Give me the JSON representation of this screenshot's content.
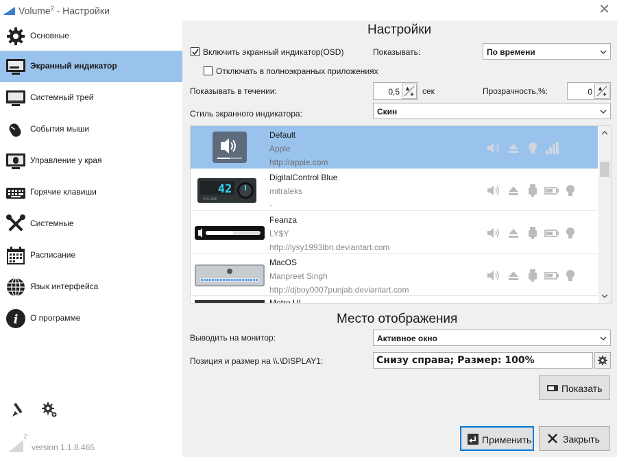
{
  "window": {
    "title": "Volume",
    "title_sup": "2",
    "title_suffix": " - Настройки"
  },
  "sidebar": {
    "items": [
      {
        "label": "Основные",
        "icon": "gear-icon"
      },
      {
        "label": "Экранный индикатор",
        "icon": "monitor-icon",
        "active": true
      },
      {
        "label": "Системный трей",
        "icon": "tray-icon"
      },
      {
        "label": "События мыши",
        "icon": "mouse-icon"
      },
      {
        "label": "Управление у края",
        "icon": "screen-edge-icon"
      },
      {
        "label": "Горячие клавиши",
        "icon": "keyboard-icon"
      },
      {
        "label": "Системные",
        "icon": "tools-icon"
      },
      {
        "label": "Расписание",
        "icon": "calendar-icon"
      },
      {
        "label": "Язык интерфейса",
        "icon": "globe-icon"
      },
      {
        "label": "О программе",
        "icon": "info-icon"
      }
    ],
    "version": "version 1.1.8.465",
    "logo_sup": "2"
  },
  "settings": {
    "title": "Настройки",
    "osd_checkbox": {
      "label": "Включить экранный индикатор(OSD)",
      "checked": true
    },
    "fullscreen_checkbox": {
      "label": "Отключать в полноэкранных приложениях",
      "checked": false
    },
    "show_label": "Показывать:",
    "show_value": "По времени",
    "duration_label": "Показывать в течении:",
    "duration_value": "0,5",
    "duration_unit": "сек",
    "opacity_label": "Прозрачность,%:",
    "opacity_value": "0",
    "style_label": "Стиль экранного индикатора:",
    "style_value": "Скин"
  },
  "skins": [
    {
      "name": "Default",
      "author": "Apple",
      "url": "http://apple.com",
      "selected": true
    },
    {
      "name": "DigitalControl Blue",
      "author": "mitraleks",
      "url": "-",
      "display": "42",
      "thumb_label": "VOLUME"
    },
    {
      "name": "Feanza",
      "author": "LY$Y",
      "url": "http://lysy1993lbn.deviantart.com"
    },
    {
      "name": "MacOS",
      "author": "Manpreet Singh",
      "url": "http://djboy0007punjab.deviantart.com"
    },
    {
      "name": "Metro UI",
      "author": "",
      "url": ""
    }
  ],
  "placement": {
    "title": "Место отображения",
    "monitor_label": "Выводить на монитор:",
    "monitor_value": "Активное окно",
    "position_label": "Позиция и размер на \\\\.\\DISPLAY1:",
    "position_value": "Снизу справа; Размер: 100%",
    "show_button": "Показать"
  },
  "footer": {
    "apply_button": "Применить",
    "close_button": "Закрыть"
  },
  "colors": {
    "accent": "#99c3ec",
    "primary_border": "#0078d7"
  }
}
